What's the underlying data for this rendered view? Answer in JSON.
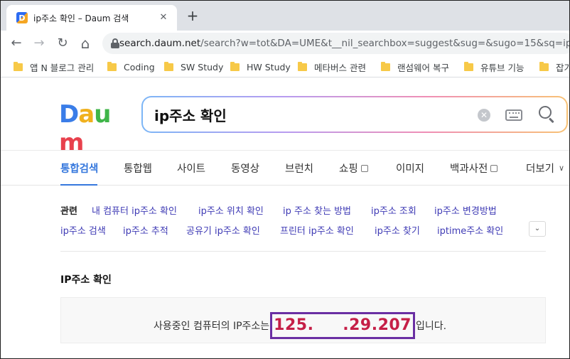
{
  "browser": {
    "tab_title": "ip주소 확인 – Daum 검색",
    "tab_favicon_letter": "D",
    "tab_close": "✕",
    "new_tab": "+",
    "url_host": "search.daum.net",
    "url_path": "/search?w=tot&DA=UME&t__nil_searchbox=suggest&sug=&sugo=15&sq=ip+&o",
    "nav_back": "←",
    "nav_forward": "→",
    "nav_reload": "↻",
    "nav_home": "⌂"
  },
  "bookmarks": [
    {
      "label": "앱 N 블로그 관리"
    },
    {
      "label": "Coding"
    },
    {
      "label": "SW Study"
    },
    {
      "label": "HW Study"
    },
    {
      "label": "메타버스 관련"
    },
    {
      "label": "랜섬웨어 복구"
    },
    {
      "label": "유튜브 기능"
    },
    {
      "label": "잡기"
    }
  ],
  "daum": {
    "logo_letters": [
      "D",
      "a",
      "u",
      "m"
    ],
    "logo_colors": [
      "#3a7de8",
      "#f0b11e",
      "#3fb548",
      "#e8414d"
    ],
    "search_query": "ip주소 확인",
    "clear_symbol": "✕"
  },
  "categories": [
    {
      "label": "통합검색",
      "active": true
    },
    {
      "label": "통합웹"
    },
    {
      "label": "사이트"
    },
    {
      "label": "동영상"
    },
    {
      "label": "브런치"
    },
    {
      "label": "쇼핑"
    },
    {
      "label": "이미지"
    },
    {
      "label": "백과사전"
    },
    {
      "label": "더보기"
    }
  ],
  "related": {
    "label": "관련",
    "toggle": "⌄",
    "items": [
      "내 컴퓨터 ip주소 확인",
      "ip주소 위치 확인",
      "ip 주소 찾는 방법",
      "ip주소 조회",
      "ip주소 변경방법",
      "ip주소 검색",
      "ip주소 추적",
      "공유기 ip주소 확인",
      "프린터 ip주소 확인",
      "ip주소 찾기",
      "iptime주소 확인"
    ]
  },
  "ip_section": {
    "title": "IP주소 확인",
    "prefix": "사용중인 컴퓨터의 IP주소는",
    "ip_value": "125.     .29.207",
    "suffix": "입니다.",
    "highlight_color": "#6a2fa3",
    "value_color": "#c51f47"
  }
}
